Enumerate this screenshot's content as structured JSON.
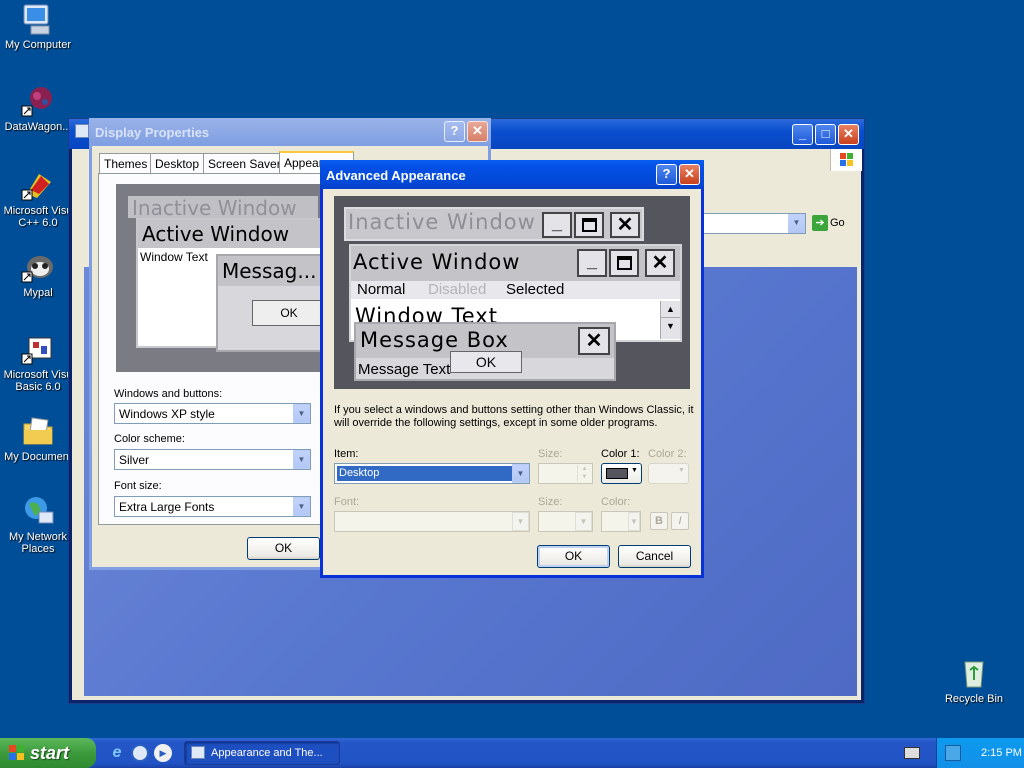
{
  "desktop": {
    "icons": [
      {
        "label": "My Computer"
      },
      {
        "label": "DataWagon..."
      },
      {
        "label": "Microsoft Visu C++ 6.0"
      },
      {
        "label": "Mypal"
      },
      {
        "label": "Microsoft Visu Basic 6.0"
      },
      {
        "label": "My Document"
      },
      {
        "label": "My Network Places"
      },
      {
        "label": "Recycle Bin"
      }
    ]
  },
  "explorer": {
    "go_label": "Go"
  },
  "display_properties": {
    "title": "Display Properties",
    "tabs": [
      "Themes",
      "Desktop",
      "Screen Saver",
      "Appearance"
    ],
    "preview": {
      "inactive_title": "Inactive Window",
      "active_title": "Active Window",
      "window_text": "Window Text",
      "message_title": "Messag...",
      "ok": "OK"
    },
    "windows_buttons_label": "Windows and buttons:",
    "windows_buttons_value": "Windows XP style",
    "color_scheme_label": "Color scheme:",
    "color_scheme_value": "Silver",
    "font_size_label": "Font size:",
    "font_size_value": "Extra Large Fonts",
    "ok_label": "OK"
  },
  "advanced": {
    "title": "Advanced Appearance",
    "preview": {
      "inactive_title": "Inactive Window",
      "active_title": "Active Window",
      "menu_normal": "Normal",
      "menu_disabled": "Disabled",
      "menu_selected": "Selected",
      "window_text": "Window Text",
      "message_title": "Message Box",
      "message_text": "Message Text",
      "ok": "OK"
    },
    "info": "If you select a windows and buttons setting other than Windows Classic, it will override the following settings, except in some older programs.",
    "item_label": "Item:",
    "item_value": "Desktop",
    "size_label": "Size:",
    "color1_label": "Color 1:",
    "color2_label": "Color 2:",
    "font_label": "Font:",
    "size2_label": "Size:",
    "color_label": "Color:",
    "bold_label": "B",
    "italic_label": "I",
    "ok_label": "OK",
    "cancel_label": "Cancel",
    "color1_value": "#55555d"
  },
  "taskbar": {
    "start_label": "start",
    "task_label": "Appearance and The...",
    "clock": "2:15 PM"
  }
}
